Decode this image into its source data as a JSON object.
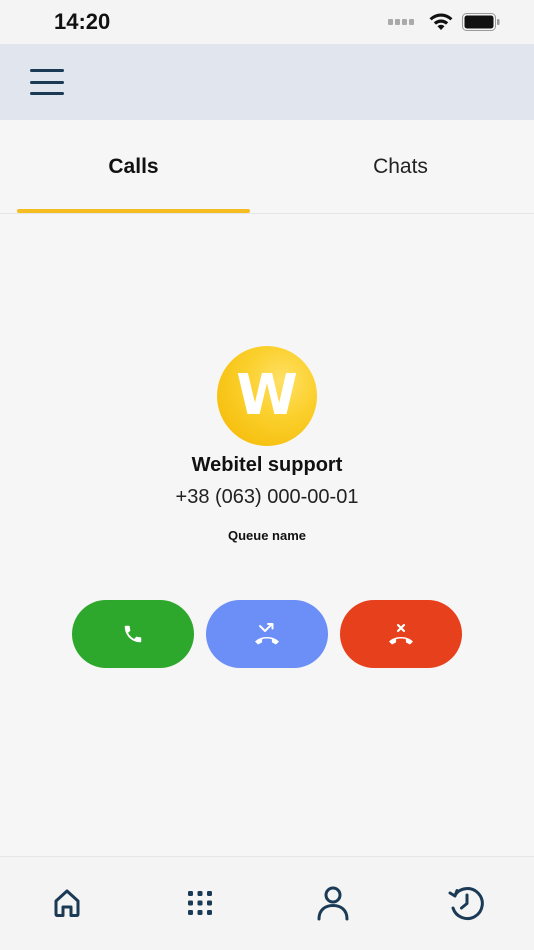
{
  "status_bar": {
    "time": "14:20"
  },
  "app_bar": {
    "menu_icon": "hamburger-menu-icon"
  },
  "tabs": [
    {
      "label": "Calls",
      "active": true
    },
    {
      "label": "Chats",
      "active": false
    }
  ],
  "colors": {
    "tab_indicator": "#f5bd1f",
    "app_bar": "#e1e5ed",
    "accept": "#2ea82c",
    "transfer": "#6b8ef7",
    "decline": "#e6401c",
    "nav_icon": "#1b3a55",
    "avatar": "#fbd02c"
  },
  "call": {
    "avatar_letter": "W",
    "name": "Webitel support",
    "number": "+38 (063) 000-00-01",
    "queue": "Queue name",
    "actions": [
      {
        "name": "accept",
        "icon": "phone-icon"
      },
      {
        "name": "transfer",
        "icon": "call-transfer-icon"
      },
      {
        "name": "decline",
        "icon": "call-end-icon"
      }
    ]
  },
  "bottom_nav": [
    {
      "name": "home",
      "icon": "home-icon"
    },
    {
      "name": "dialpad",
      "icon": "dialpad-icon"
    },
    {
      "name": "contacts",
      "icon": "person-icon"
    },
    {
      "name": "history",
      "icon": "history-icon"
    }
  ]
}
